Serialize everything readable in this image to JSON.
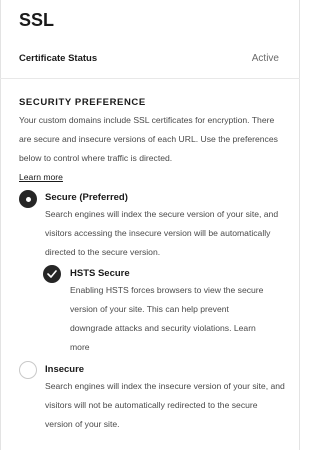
{
  "page": {
    "title": "SSL"
  },
  "certificate": {
    "label": "Certificate Status",
    "value": "Active"
  },
  "security": {
    "heading": "SECURITY PREFERENCE",
    "description": "Your custom domains include SSL certificates for encryption. There are secure and insecure versions of each URL. Use the preferences below to control where traffic is directed.",
    "learn_more": "Learn more"
  },
  "options": {
    "secure": {
      "title": "Secure (Preferred)",
      "description": "Search engines will index the secure version of your site, and visitors accessing the insecure version will be automatically directed to the secure version.",
      "selected": true
    },
    "hsts": {
      "title": "HSTS Secure",
      "description": "Enabling HSTS forces browsers to view the secure version of your site. This can help prevent downgrade attacks and security violations.",
      "learn_more": "Learn more",
      "checked": true
    },
    "insecure": {
      "title": "Insecure",
      "description": "Search engines will index the insecure version of your site, and visitors will not be automatically redirected to the secure version of your site.",
      "selected": false
    }
  },
  "icons": {
    "radio_selected": "radio-selected-icon",
    "radio_unselected": "radio-unselected-icon",
    "checkmark": "checkmark-icon"
  },
  "colors": {
    "text": "#1a1a1a",
    "muted": "#4a4a4a",
    "status": "#6a6a6a",
    "control": "#262626"
  }
}
